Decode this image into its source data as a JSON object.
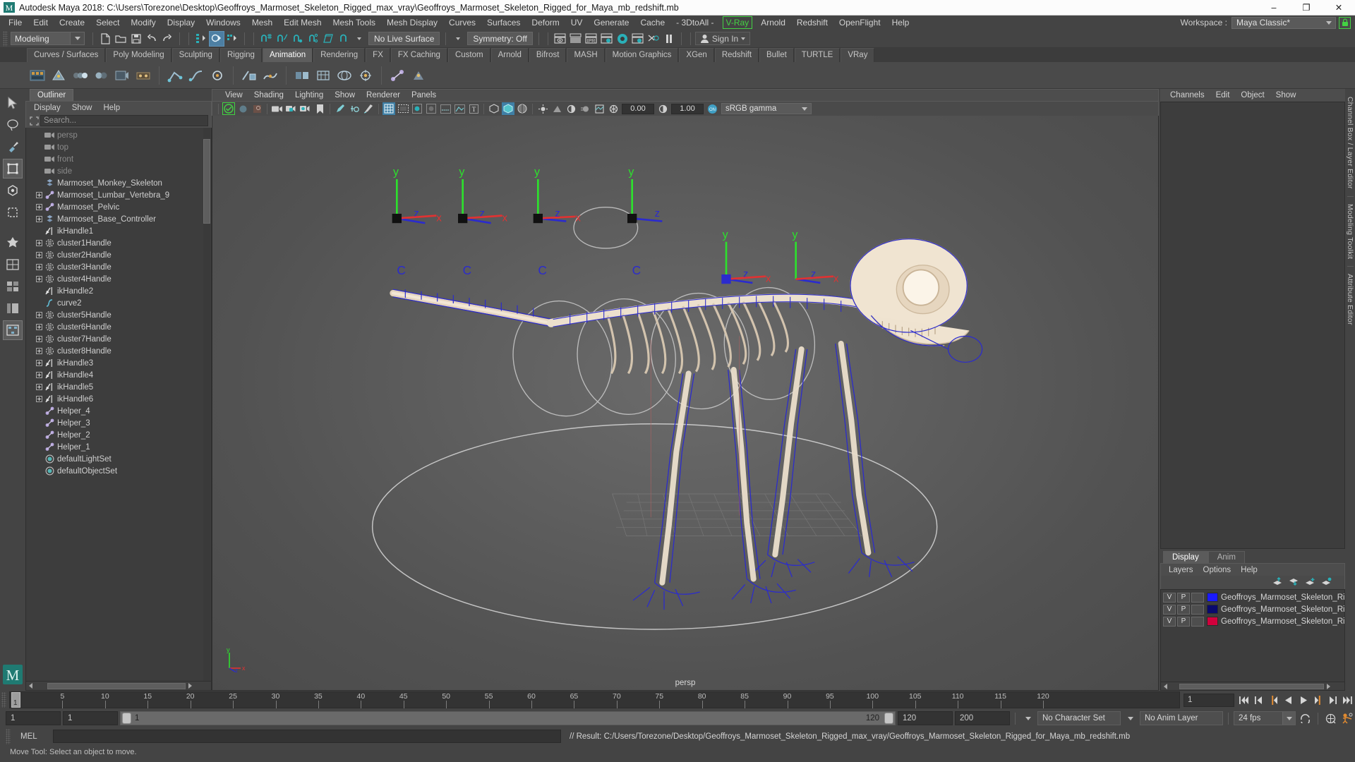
{
  "window": {
    "title": "Autodesk Maya 2018: C:\\Users\\Torezone\\Desktop\\Geoffroys_Marmoset_Skeleton_Rigged_max_vray\\Geoffroys_Marmoset_Skeleton_Rigged_for_Maya_mb_redshift.mb",
    "minimize": "–",
    "maximize": "❐",
    "close": "✕"
  },
  "menubar": {
    "items": [
      {
        "label": "File"
      },
      {
        "label": "Edit"
      },
      {
        "label": "Create"
      },
      {
        "label": "Select"
      },
      {
        "label": "Modify"
      },
      {
        "label": "Display"
      },
      {
        "label": "Windows"
      },
      {
        "label": "Mesh"
      },
      {
        "label": "Edit Mesh"
      },
      {
        "label": "Mesh Tools"
      },
      {
        "label": "Mesh Display"
      },
      {
        "label": "Curves"
      },
      {
        "label": "Surfaces"
      },
      {
        "label": "Deform"
      },
      {
        "label": "UV"
      },
      {
        "label": "Generate"
      },
      {
        "label": "Cache"
      },
      {
        "label": "- 3DtoAll -"
      },
      {
        "label": "V-Ray",
        "highlight": true
      },
      {
        "label": "Arnold"
      },
      {
        "label": "Redshift"
      },
      {
        "label": "OpenFlight"
      },
      {
        "label": "Help"
      }
    ],
    "workspace_label": "Workspace :",
    "workspace_value": "Maya Classic*"
  },
  "toolbar": {
    "mode": "Modeling",
    "live_surface": "No Live Surface",
    "symmetry": "Symmetry: Off",
    "signin": "Sign In"
  },
  "shelf": {
    "tabs": [
      {
        "label": "Curves / Surfaces"
      },
      {
        "label": "Poly Modeling"
      },
      {
        "label": "Sculpting"
      },
      {
        "label": "Rigging"
      },
      {
        "label": "Animation",
        "active": true
      },
      {
        "label": "Rendering"
      },
      {
        "label": "FX"
      },
      {
        "label": "FX Caching"
      },
      {
        "label": "Custom"
      },
      {
        "label": "Arnold"
      },
      {
        "label": "Bifrost"
      },
      {
        "label": "MASH"
      },
      {
        "label": "Motion Graphics"
      },
      {
        "label": "XGen"
      },
      {
        "label": "Redshift"
      },
      {
        "label": "Bullet"
      },
      {
        "label": "TURTLE"
      },
      {
        "label": "VRay"
      }
    ]
  },
  "outliner": {
    "tab": "Outliner",
    "menus": [
      "Display",
      "Show",
      "Help"
    ],
    "search_placeholder": "Search...",
    "items": [
      {
        "name": "persp",
        "icon": "camera-icon",
        "dim": true,
        "expand": false
      },
      {
        "name": "top",
        "icon": "camera-icon",
        "dim": true,
        "expand": false
      },
      {
        "name": "front",
        "icon": "camera-icon",
        "dim": true,
        "expand": false
      },
      {
        "name": "side",
        "icon": "camera-icon",
        "dim": true,
        "expand": false
      },
      {
        "name": "Marmoset_Monkey_Skeleton",
        "icon": "group-icon",
        "dim": false,
        "expand": false
      },
      {
        "name": "Marmoset_Lumbar_Vertebra_9",
        "icon": "joint-icon",
        "dim": false,
        "expand": true
      },
      {
        "name": "Marmoset_Pelvic",
        "icon": "joint-icon",
        "dim": false,
        "expand": true
      },
      {
        "name": "Marmoset_Base_Controller",
        "icon": "group-icon",
        "dim": false,
        "expand": true
      },
      {
        "name": "ikHandle1",
        "icon": "ikhandle-icon",
        "dim": false,
        "expand": false
      },
      {
        "name": "cluster1Handle",
        "icon": "cluster-icon",
        "dim": false,
        "expand": true
      },
      {
        "name": "cluster2Handle",
        "icon": "cluster-icon",
        "dim": false,
        "expand": true
      },
      {
        "name": "cluster3Handle",
        "icon": "cluster-icon",
        "dim": false,
        "expand": true
      },
      {
        "name": "cluster4Handle",
        "icon": "cluster-icon",
        "dim": false,
        "expand": true
      },
      {
        "name": "ikHandle2",
        "icon": "ikhandle-icon",
        "dim": false,
        "expand": false
      },
      {
        "name": "curve2",
        "icon": "curve-icon",
        "dim": false,
        "expand": false
      },
      {
        "name": "cluster5Handle",
        "icon": "cluster-icon",
        "dim": false,
        "expand": true
      },
      {
        "name": "cluster6Handle",
        "icon": "cluster-icon",
        "dim": false,
        "expand": true
      },
      {
        "name": "cluster7Handle",
        "icon": "cluster-icon",
        "dim": false,
        "expand": true
      },
      {
        "name": "cluster8Handle",
        "icon": "cluster-icon",
        "dim": false,
        "expand": true
      },
      {
        "name": "ikHandle3",
        "icon": "ikhandle-icon",
        "dim": false,
        "expand": true
      },
      {
        "name": "ikHandle4",
        "icon": "ikhandle-icon",
        "dim": false,
        "expand": true
      },
      {
        "name": "ikHandle5",
        "icon": "ikhandle-icon",
        "dim": false,
        "expand": true
      },
      {
        "name": "ikHandle6",
        "icon": "ikhandle-icon",
        "dim": false,
        "expand": true
      },
      {
        "name": "Helper_4",
        "icon": "joint-icon",
        "dim": false,
        "expand": false
      },
      {
        "name": "Helper_3",
        "icon": "joint-icon",
        "dim": false,
        "expand": false
      },
      {
        "name": "Helper_2",
        "icon": "joint-icon",
        "dim": false,
        "expand": false
      },
      {
        "name": "Helper_1",
        "icon": "joint-icon",
        "dim": false,
        "expand": false
      },
      {
        "name": "defaultLightSet",
        "icon": "set-icon",
        "dim": false,
        "expand": false
      },
      {
        "name": "defaultObjectSet",
        "icon": "set-icon",
        "dim": false,
        "expand": false
      }
    ]
  },
  "viewport": {
    "menus": [
      "View",
      "Shading",
      "Lighting",
      "Show",
      "Renderer",
      "Panels"
    ],
    "exposure": "0.00",
    "gamma": "1.00",
    "color_space": "sRGB gamma",
    "camera_label": "persp",
    "axis_labels": {
      "x": "x",
      "y": "y",
      "z": "z"
    },
    "manipulator_labels": [
      "y",
      "z",
      "x",
      "C"
    ]
  },
  "channelbox": {
    "menus": [
      "Channels",
      "Edit",
      "Object",
      "Show"
    ]
  },
  "layereditor": {
    "tabs": [
      {
        "label": "Display",
        "active": true
      },
      {
        "label": "Anim",
        "active": false
      }
    ],
    "menus": [
      "Layers",
      "Options",
      "Help"
    ],
    "col_v": "V",
    "col_p": "P",
    "layers": [
      {
        "v": "V",
        "p": "P",
        "color": "#1a1aff",
        "name": "Geoffroys_Marmoset_Skeleton_Rigged_Co"
      },
      {
        "v": "V",
        "p": "P",
        "color": "#0a0a6e",
        "name": "Geoffroys_Marmoset_Skeleton_Rigged_Bo"
      },
      {
        "v": "V",
        "p": "P",
        "color": "#d1003c",
        "name": "Geoffroys_Marmoset_Skeleton_Rigged"
      }
    ]
  },
  "sidestrip": {
    "labels": [
      "Channel Box / Layer Editor",
      "Modeling Toolkit",
      "Attribute Editor"
    ]
  },
  "timeline": {
    "current_frame": "1",
    "frame_field": "1",
    "ticks": [
      5,
      10,
      15,
      20,
      25,
      30,
      35,
      40,
      45,
      50,
      55,
      60,
      65,
      70,
      75,
      80,
      85,
      90,
      95,
      100,
      105,
      110,
      115,
      120
    ],
    "range_start": 1,
    "range_end": 120
  },
  "rangebar": {
    "anim_start": "1",
    "range_start": "1",
    "slider_min": "1",
    "slider_max": "120",
    "range_end": "120",
    "anim_end": "200",
    "character_set": "No Character Set",
    "anim_layer": "No Anim Layer",
    "fps": "24 fps"
  },
  "commandline": {
    "language": "MEL",
    "input_value": "",
    "result": "// Result: C:/Users/Torezone/Desktop/Geoffroys_Marmoset_Skeleton_Rigged_max_vray/Geoffroys_Marmoset_Skeleton_Rigged_for_Maya_mb_redshift.mb"
  },
  "statusbar": {
    "message": "Move Tool: Select an object to move."
  },
  "colors": {
    "accent_teal": "#2ab0b8",
    "green_highlight": "#43d243",
    "panel_bg": "#444444",
    "list_bg": "#3d3d3d",
    "selected_blue": "#4d7fa3"
  }
}
